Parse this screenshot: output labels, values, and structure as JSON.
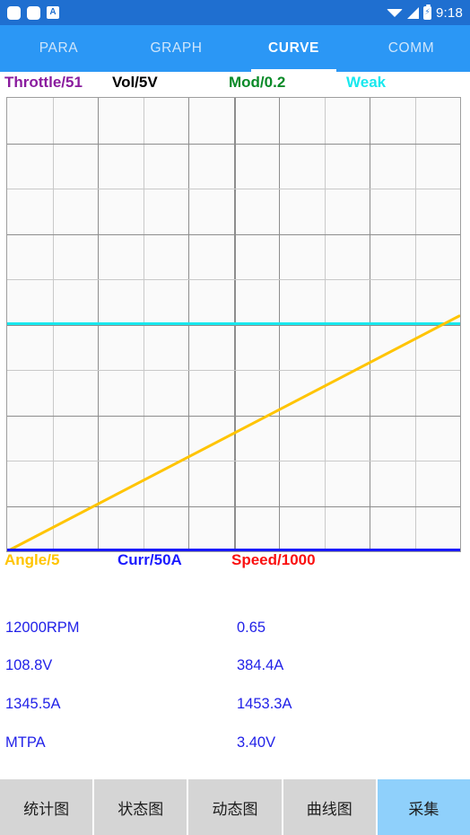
{
  "status_bar": {
    "icons": [
      "app-square-icon",
      "app-square-icon",
      "a-badge-icon"
    ],
    "a_badge_text": "A",
    "right_icons": [
      "wifi-icon",
      "signal-icon",
      "battery-icon"
    ],
    "time": "9:18",
    "background": "#1f6fd0"
  },
  "tab_bar": {
    "background": "#2b97f5",
    "active_index": 2,
    "tabs": [
      {
        "label": "PARA"
      },
      {
        "label": "GRAPH"
      },
      {
        "label": "CURVE"
      },
      {
        "label": "COMM"
      }
    ]
  },
  "chart_data": {
    "type": "line",
    "title": "",
    "xlabel": "",
    "ylabel": "",
    "grid": true,
    "grid_cols": 10,
    "grid_rows": 10,
    "xlim": [
      0,
      10
    ],
    "ylim": [
      0,
      10
    ],
    "legend_position": "top-and-bottom",
    "top_legend": [
      {
        "label": "Throttle/51",
        "color": "#8a1c9e"
      },
      {
        "label": "Vol/5V",
        "color": "#000000"
      },
      {
        "label": "Mod/0.2",
        "color": "#0a8a28"
      },
      {
        "label": "Weak",
        "color": "#18e8ee"
      }
    ],
    "bottom_legend": [
      {
        "label": "Angle/5",
        "color": "#ffc400"
      },
      {
        "label": "Curr/50A",
        "color": "#1a1aff"
      },
      {
        "label": "Speed/1000",
        "color": "#fa1010"
      }
    ],
    "series": [
      {
        "name": "Weak",
        "color": "#18e8ee",
        "type": "line",
        "x": [
          0,
          10
        ],
        "values": [
          5.05,
          5.05
        ]
      },
      {
        "name": "Angle/5",
        "color": "#ffc400",
        "type": "line",
        "x": [
          0,
          10
        ],
        "values": [
          0.0,
          5.2
        ]
      },
      {
        "name": "Curr/50A",
        "color": "#1a1aff",
        "type": "line",
        "x": [
          0,
          10
        ],
        "values": [
          0.0,
          0.0
        ]
      }
    ]
  },
  "readouts": {
    "rows": [
      {
        "left": "12000RPM",
        "right": "0.65"
      },
      {
        "left": "108.8V",
        "right": "384.4A"
      },
      {
        "left": "1345.5A",
        "right": "1453.3A"
      },
      {
        "left": "MTPA",
        "right": "3.40V"
      }
    ],
    "color": "#2222e8"
  },
  "button_bar": {
    "active_index": 4,
    "buttons": [
      {
        "label": "统计图"
      },
      {
        "label": "状态图"
      },
      {
        "label": "动态图"
      },
      {
        "label": "曲线图"
      },
      {
        "label": "采集"
      }
    ],
    "inactive_background": "#d5d5d5",
    "active_background": "#8fd0fb"
  }
}
